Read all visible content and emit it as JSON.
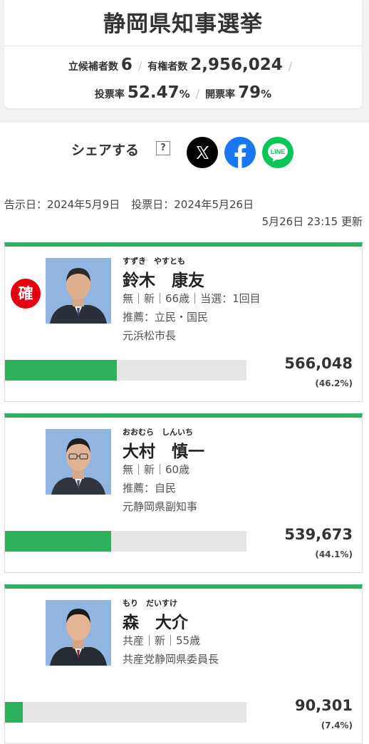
{
  "election": {
    "title": "静岡県知事選挙",
    "stats": [
      {
        "label": "立候補者数",
        "value": "6",
        "unit": ""
      },
      {
        "label": "有権者数",
        "value": "2,956,024",
        "unit": ""
      },
      {
        "label": "投票率",
        "value": "52.47",
        "unit": "%"
      },
      {
        "label": "開票率",
        "value": "79",
        "unit": "%"
      }
    ],
    "separator": "/"
  },
  "share": {
    "label": "シェアする",
    "help": "?",
    "buttons": [
      {
        "name": "x-share-button",
        "icon": "x-logo-icon"
      },
      {
        "name": "facebook-share-button",
        "icon": "facebook-logo-icon"
      },
      {
        "name": "line-share-button",
        "icon": "line-logo-icon",
        "text": "LINE"
      }
    ]
  },
  "dates": {
    "notice": "告示日：2024年5月9日",
    "vote": "投票日：2024年5月26日",
    "updated": "5月26日 23:15 更新"
  },
  "candidates": [
    {
      "kana": "すずき　やすとも",
      "name": "鈴木　康友",
      "line1": "無｜新｜66歳｜当選：1回目",
      "line2": "推薦：立民・国民",
      "line3": "元浜松市長",
      "votes": "566,048",
      "percent": "(46.2%)",
      "share": 0.462,
      "badge": "確"
    },
    {
      "kana": "おおむら　しんいち",
      "name": "大村　慎一",
      "line1": "無｜新｜60歳",
      "line2": "推薦：自民",
      "line3": "元静岡県副知事",
      "votes": "539,673",
      "percent": "(44.1%)",
      "share": 0.441
    },
    {
      "kana": "もり　だいすけ",
      "name": "森　大介",
      "line1": "共産｜新｜55歳",
      "line2": "共産党静岡県委員長",
      "line3": "",
      "votes": "90,301",
      "percent": "(7.4%)",
      "share": 0.074
    }
  ],
  "colors": {
    "accent_green": "#2db15e",
    "winner_red": "#e60012",
    "bar_track": "#e5e5e5"
  }
}
